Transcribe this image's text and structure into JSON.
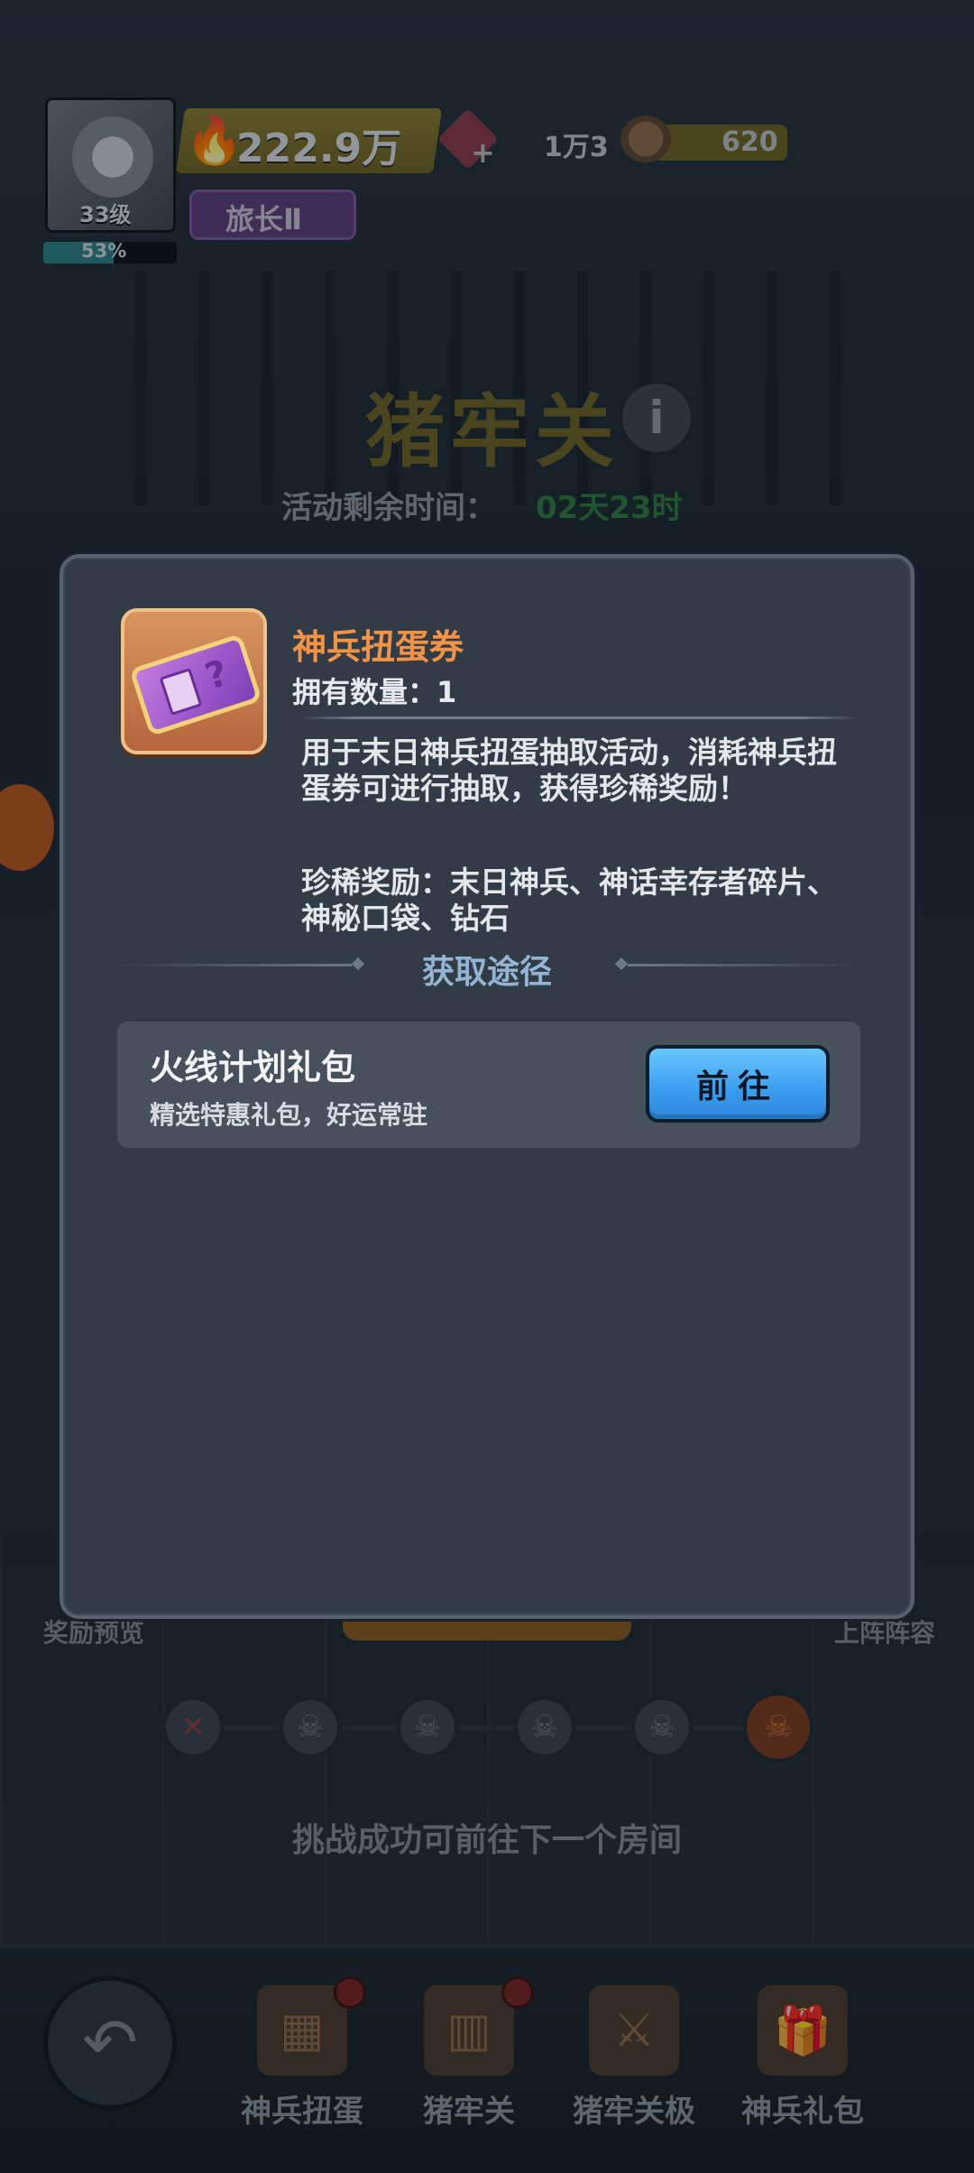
{
  "hud": {
    "level": "33级",
    "xp_percent": "53%",
    "xp_fraction": 0.53,
    "power": "222.9万",
    "rank": "旅长Ⅱ",
    "gems": "1万3",
    "wood": "620"
  },
  "stage": {
    "title": "猪牢关",
    "timer_label": "活动剩余时间：",
    "timer_value": "02天23时"
  },
  "modal": {
    "item_name": "神兵扭蛋券",
    "item_count": "拥有数量：1",
    "description": "用于末日神兵扭蛋抽取活动，消耗神兵扭蛋券可进行抽取，获得珍稀奖励！",
    "reward": "珍稀奖励：末日神兵、神话幸存者碎片、神秘口袋、钻石",
    "source_title": "获取途径",
    "sources": [
      {
        "name": "火线计划礼包",
        "sub": "精选特惠礼包，好运常驻",
        "button": "前往"
      }
    ]
  },
  "background": {
    "left_label": "奖励预览",
    "right_label": "上阵阵容",
    "hint": "挑战成功可前往下一个房间"
  },
  "nav": {
    "tabs": [
      {
        "label": "神兵扭蛋",
        "icon": "capsule-machine-icon"
      },
      {
        "label": "猪牢关",
        "icon": "prison-weapon-icon"
      },
      {
        "label": "猪牢关极",
        "icon": "extreme-weapon-icon"
      },
      {
        "label": "神兵礼包",
        "icon": "gift-box-icon"
      }
    ]
  },
  "colors": {
    "modal_bg": "#323c47",
    "item_name": "#f29346",
    "source_title": "#93b4d2",
    "go_button": "#3a9df0"
  }
}
